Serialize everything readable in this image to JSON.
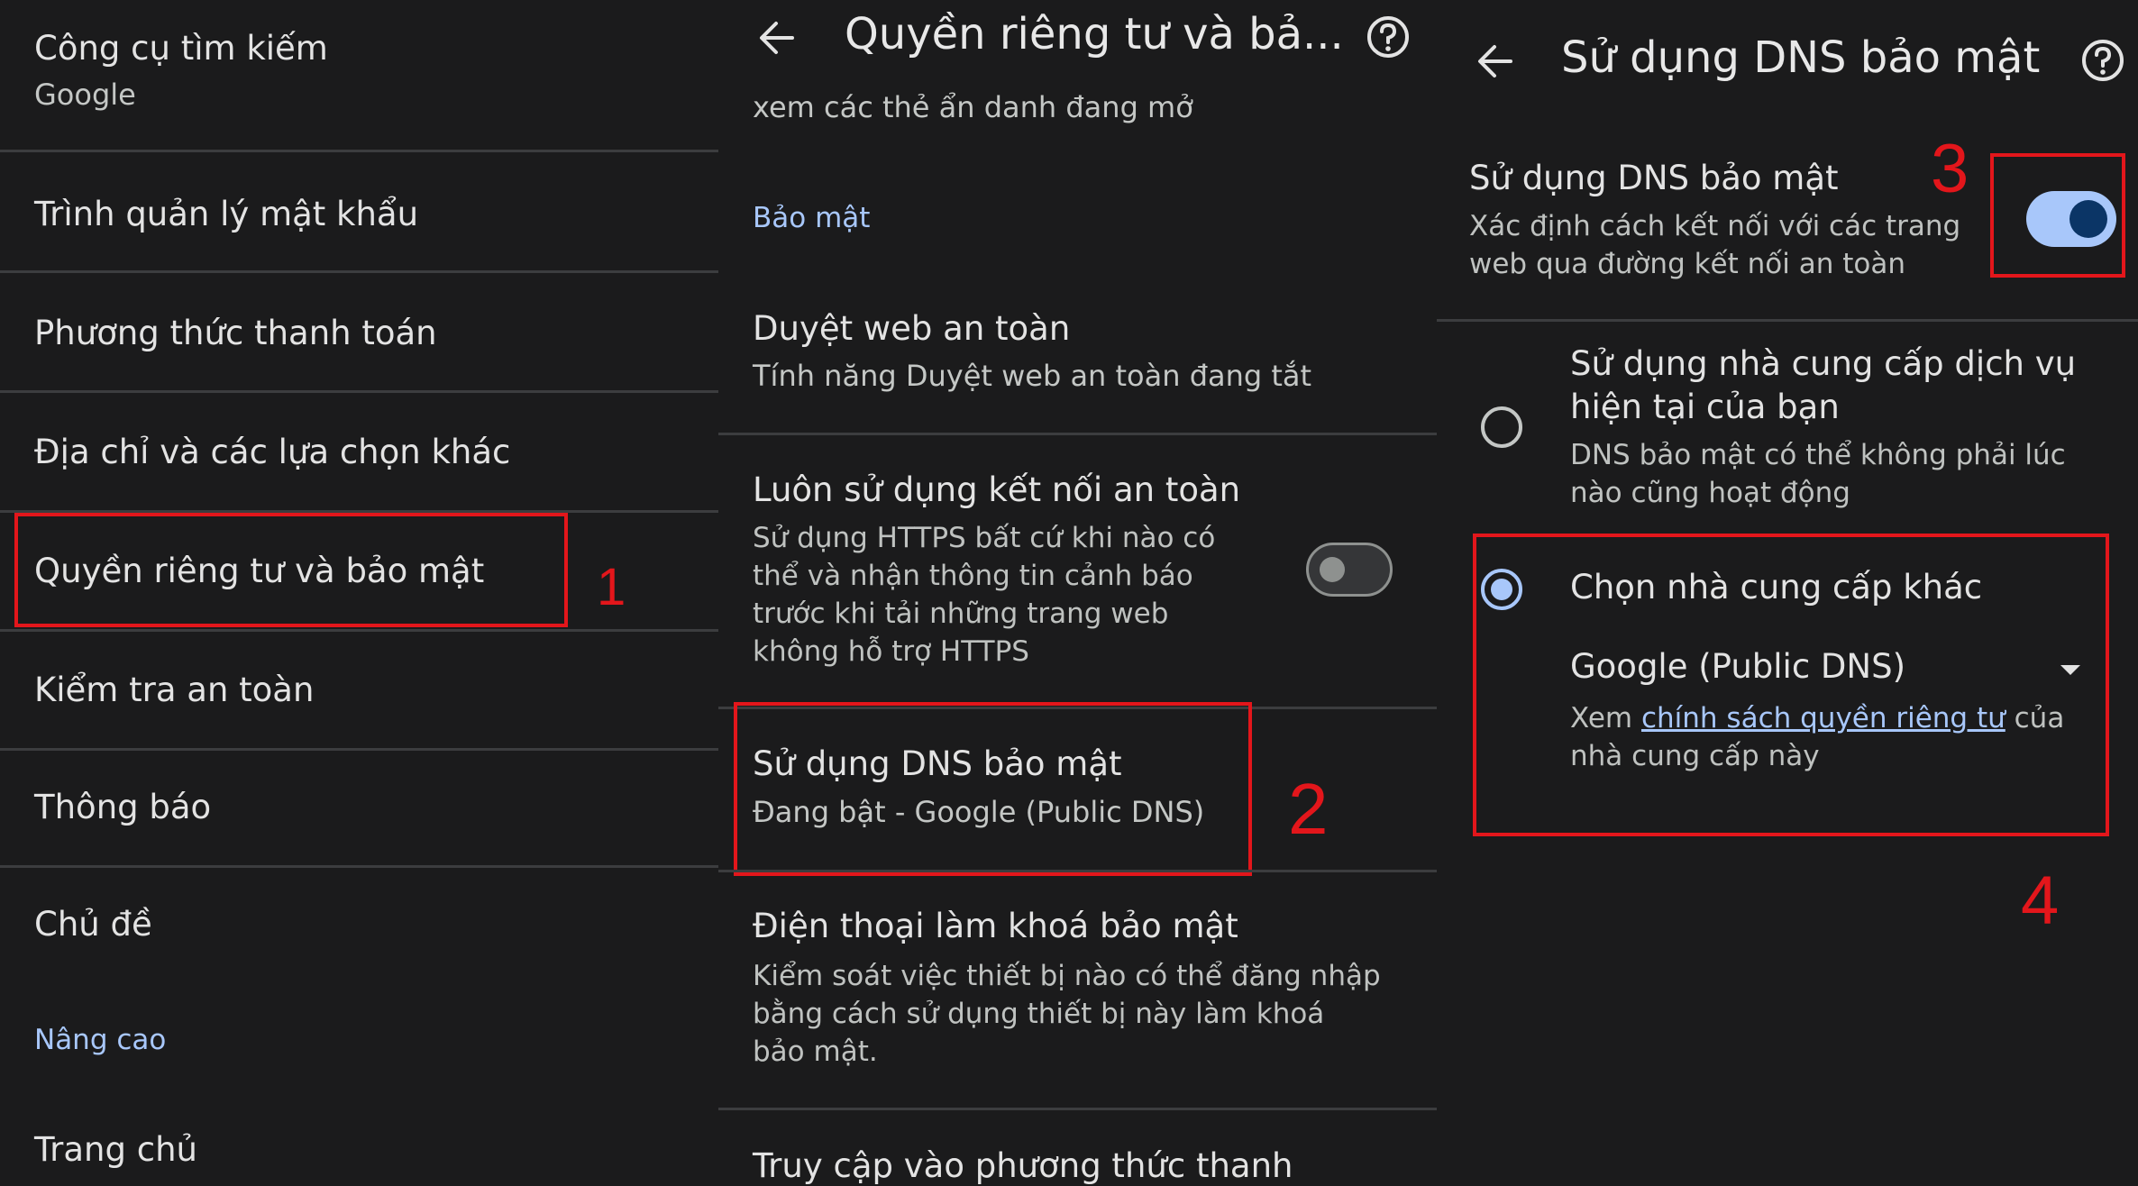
{
  "panel1": {
    "search_engine": {
      "title": "Công cụ tìm kiếm",
      "value": "Google"
    },
    "items": [
      {
        "label": "Trình quản lý mật khẩu"
      },
      {
        "label": "Phương thức thanh toán"
      },
      {
        "label": "Địa chỉ và các lựa chọn khác"
      },
      {
        "label": "Quyền riêng tư và bảo mật"
      },
      {
        "label": "Kiểm tra an toàn"
      },
      {
        "label": "Thông báo"
      },
      {
        "label": "Chủ đề"
      }
    ],
    "section_advanced": "Nâng cao",
    "home": "Trang chủ",
    "step": "1"
  },
  "panel2": {
    "header_title": "Quyền riêng tư và bả...",
    "scrolled_text": "xem các thẻ ẩn danh đang mở",
    "section_security": "Bảo mật",
    "safe_browsing": {
      "title": "Duyệt web an toàn",
      "desc": "Tính năng Duyệt web an toàn đang tắt"
    },
    "https_always": {
      "title": "Luôn sử dụng kết nối an toàn",
      "desc": "Sử dụng HTTPS bất cứ khi nào có thể và nhận thông tin cảnh báo trước khi tải những trang web không hỗ trợ HTTPS",
      "enabled": false
    },
    "secure_dns": {
      "title": "Sử dụng DNS bảo mật",
      "desc": "Đang bật - Google (Public DNS)"
    },
    "security_key": {
      "title": "Điện thoại làm khoá bảo mật",
      "desc": "Kiểm soát việc thiết bị nào có thể đăng nhập bằng cách sử dụng thiết bị này làm khoá bảo mật."
    },
    "payment_access": "Truy cập vào phương thức thanh",
    "step": "2"
  },
  "panel3": {
    "header_title": "Sử dụng DNS bảo mật",
    "toggle_row": {
      "title": "Sử dụng DNS bảo mật",
      "desc": "Xác định cách kết nối với các trang web qua đường kết nối an toàn",
      "enabled": true
    },
    "option_current": {
      "title": "Sử dụng nhà cung cấp dịch vụ hiện tại của bạn",
      "desc": "DNS bảo mật có thể không phải lúc nào cũng hoạt động",
      "selected": false
    },
    "option_other": {
      "title": "Chọn nhà cung cấp khác",
      "selected": true,
      "provider": "Google (Public DNS)",
      "note_prefix": "Xem ",
      "note_link": "chính sách quyền riêng tư",
      "note_suffix": " của nhà cung cấp này"
    },
    "step3": "3",
    "step4": "4"
  },
  "colors": {
    "panel_bg": "#1b1b1c",
    "accent_blue": "#a8c7fa",
    "toggle_on_track": "#a8c7fa",
    "toggle_on_thumb": "#0b3566",
    "highlight_red": "#e3161b"
  },
  "icons": [
    "back-arrow-icon",
    "help-icon",
    "dropdown-arrow-icon",
    "radio-icon"
  ]
}
